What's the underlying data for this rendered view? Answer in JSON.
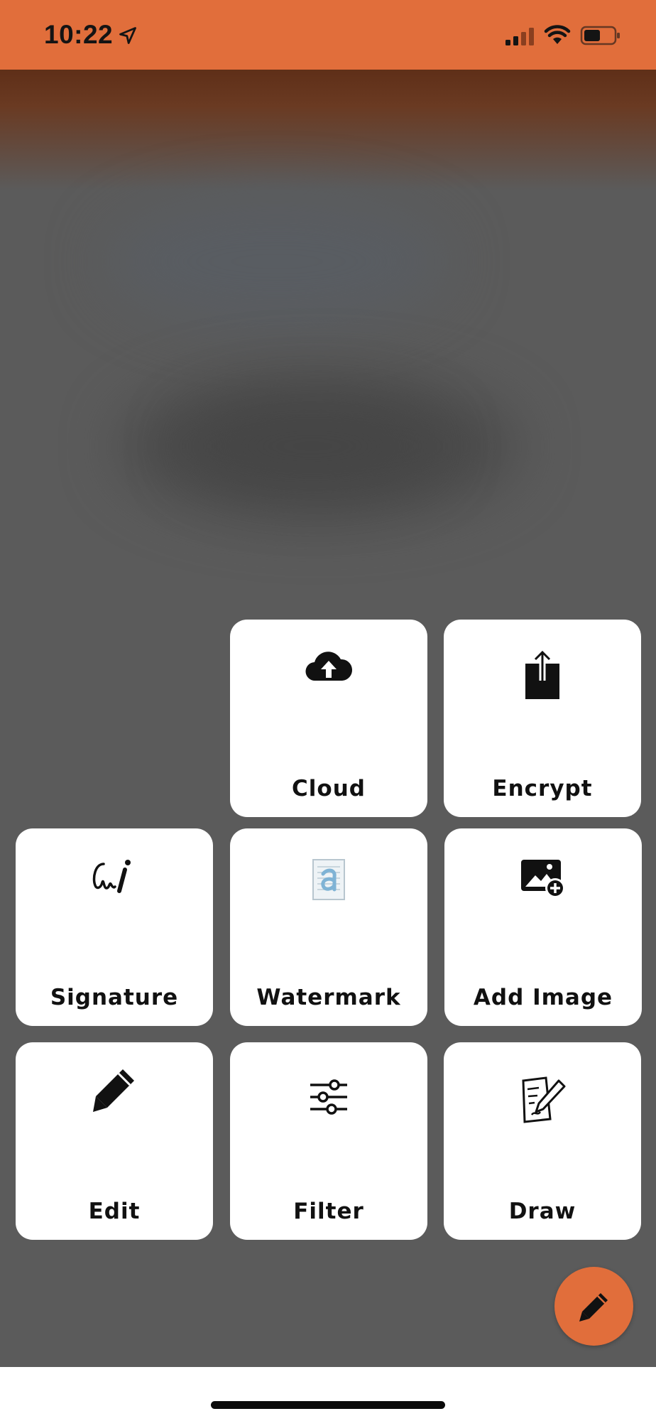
{
  "status_bar": {
    "time": "10:22",
    "location_icon": "location-arrow-icon",
    "signal_icon": "cellular-signal-icon",
    "wifi_icon": "wifi-icon",
    "battery_icon": "battery-icon"
  },
  "colors": {
    "accent": "#e16e3b",
    "overlay": "#5b5b5b",
    "tile_bg": "#ffffff",
    "text": "#111111"
  },
  "menu": {
    "cloud": {
      "label": "Cloud",
      "icon": "cloud-upload-icon"
    },
    "encrypt": {
      "label": "Encrypt",
      "icon": "share-export-icon"
    },
    "signature": {
      "label": "Signature",
      "icon": "signature-icon"
    },
    "watermark": {
      "label": "Watermark",
      "icon": "watermark-document-icon"
    },
    "add_image": {
      "label": "Add Image",
      "icon": "add-image-icon"
    },
    "edit": {
      "label": "Edit",
      "icon": "pencil-icon"
    },
    "filter": {
      "label": "Filter",
      "icon": "sliders-icon"
    },
    "draw": {
      "label": "Draw",
      "icon": "draw-document-icon"
    }
  },
  "fab": {
    "icon": "pencil-icon"
  }
}
